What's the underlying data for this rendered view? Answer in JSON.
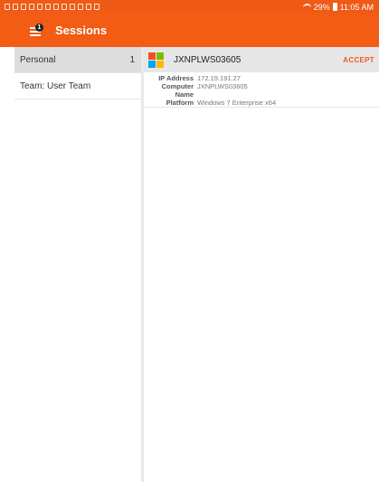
{
  "status_bar": {
    "battery_percent": "29%",
    "time": "11:05 AM"
  },
  "app_bar": {
    "title": "Sessions",
    "menu_badge": "1"
  },
  "sidebar": {
    "items": [
      {
        "label": "Personal",
        "count": "1",
        "selected": true
      },
      {
        "label": "Team: User Team",
        "count": "",
        "selected": false
      }
    ]
  },
  "session": {
    "name": "JXNPLWS03605",
    "action_label": "ACCEPT",
    "details": [
      {
        "label": "IP Address",
        "value": "172.19.191.27"
      },
      {
        "label": "Computer Name",
        "value": "JXNPLWS03605"
      },
      {
        "label": "Platform",
        "value": "Windows 7 Enterprise x64"
      }
    ]
  },
  "colors": {
    "accent": "#f25c14",
    "status_bar": "#ef5a17",
    "selected_row": "#dddddd"
  }
}
